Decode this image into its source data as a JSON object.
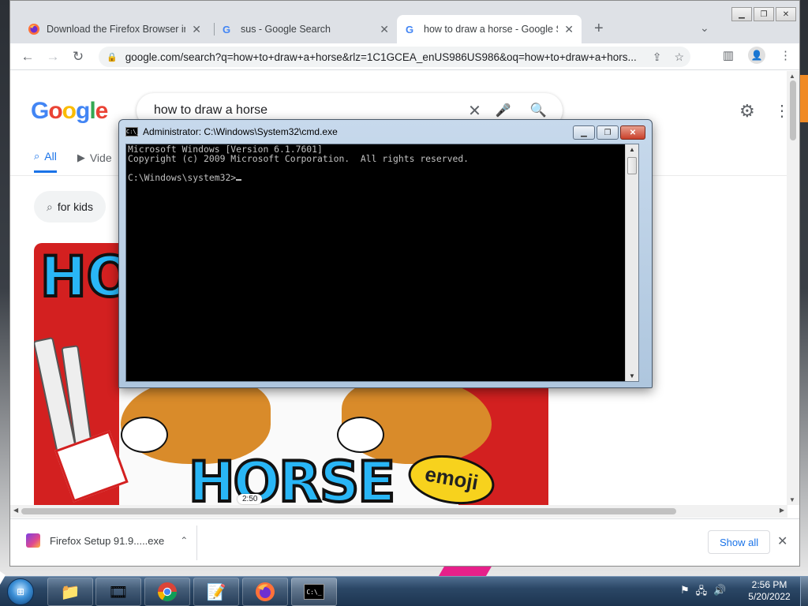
{
  "browser": {
    "tabs": [
      {
        "title": "Download the Firefox Browser in",
        "favicon": "firefox-icon"
      },
      {
        "title": "sus - Google Search",
        "favicon": "google-icon"
      },
      {
        "title": "how to draw a horse - Google Se",
        "favicon": "google-icon"
      }
    ],
    "address": "google.com/search?q=how+to+draw+a+horse&rlz=1C1GCEA_enUS986US986&oq=how+to+draw+a+hors...",
    "new_tab_label": "+",
    "profile_initial": "👤"
  },
  "google": {
    "logo": "Google",
    "query": "how to draw a horse",
    "nav_tabs": [
      "All",
      "Vide"
    ],
    "chip": "for kids",
    "duration": "2:50"
  },
  "download": {
    "file": "Firefox Setup 91.9.....exe",
    "show_all": "Show all"
  },
  "cmd": {
    "title": "Administrator: C:\\Windows\\System32\\cmd.exe",
    "icon_text": "C:\\_",
    "lines": [
      "Microsoft Windows [Version 6.1.7601]",
      "Copyright (c) 2009 Microsoft Corporation.  All rights reserved.",
      "",
      "C:\\Windows\\system32>"
    ]
  },
  "thumbnail": {
    "ho": "HO",
    "horse": "HORSE",
    "emoji": "emoji"
  },
  "taskbar": {
    "time": "2:56 PM",
    "date": "5/20/2022",
    "apps": [
      "explorer",
      "media-player",
      "chrome",
      "notepad",
      "firefox",
      "cmd"
    ]
  }
}
